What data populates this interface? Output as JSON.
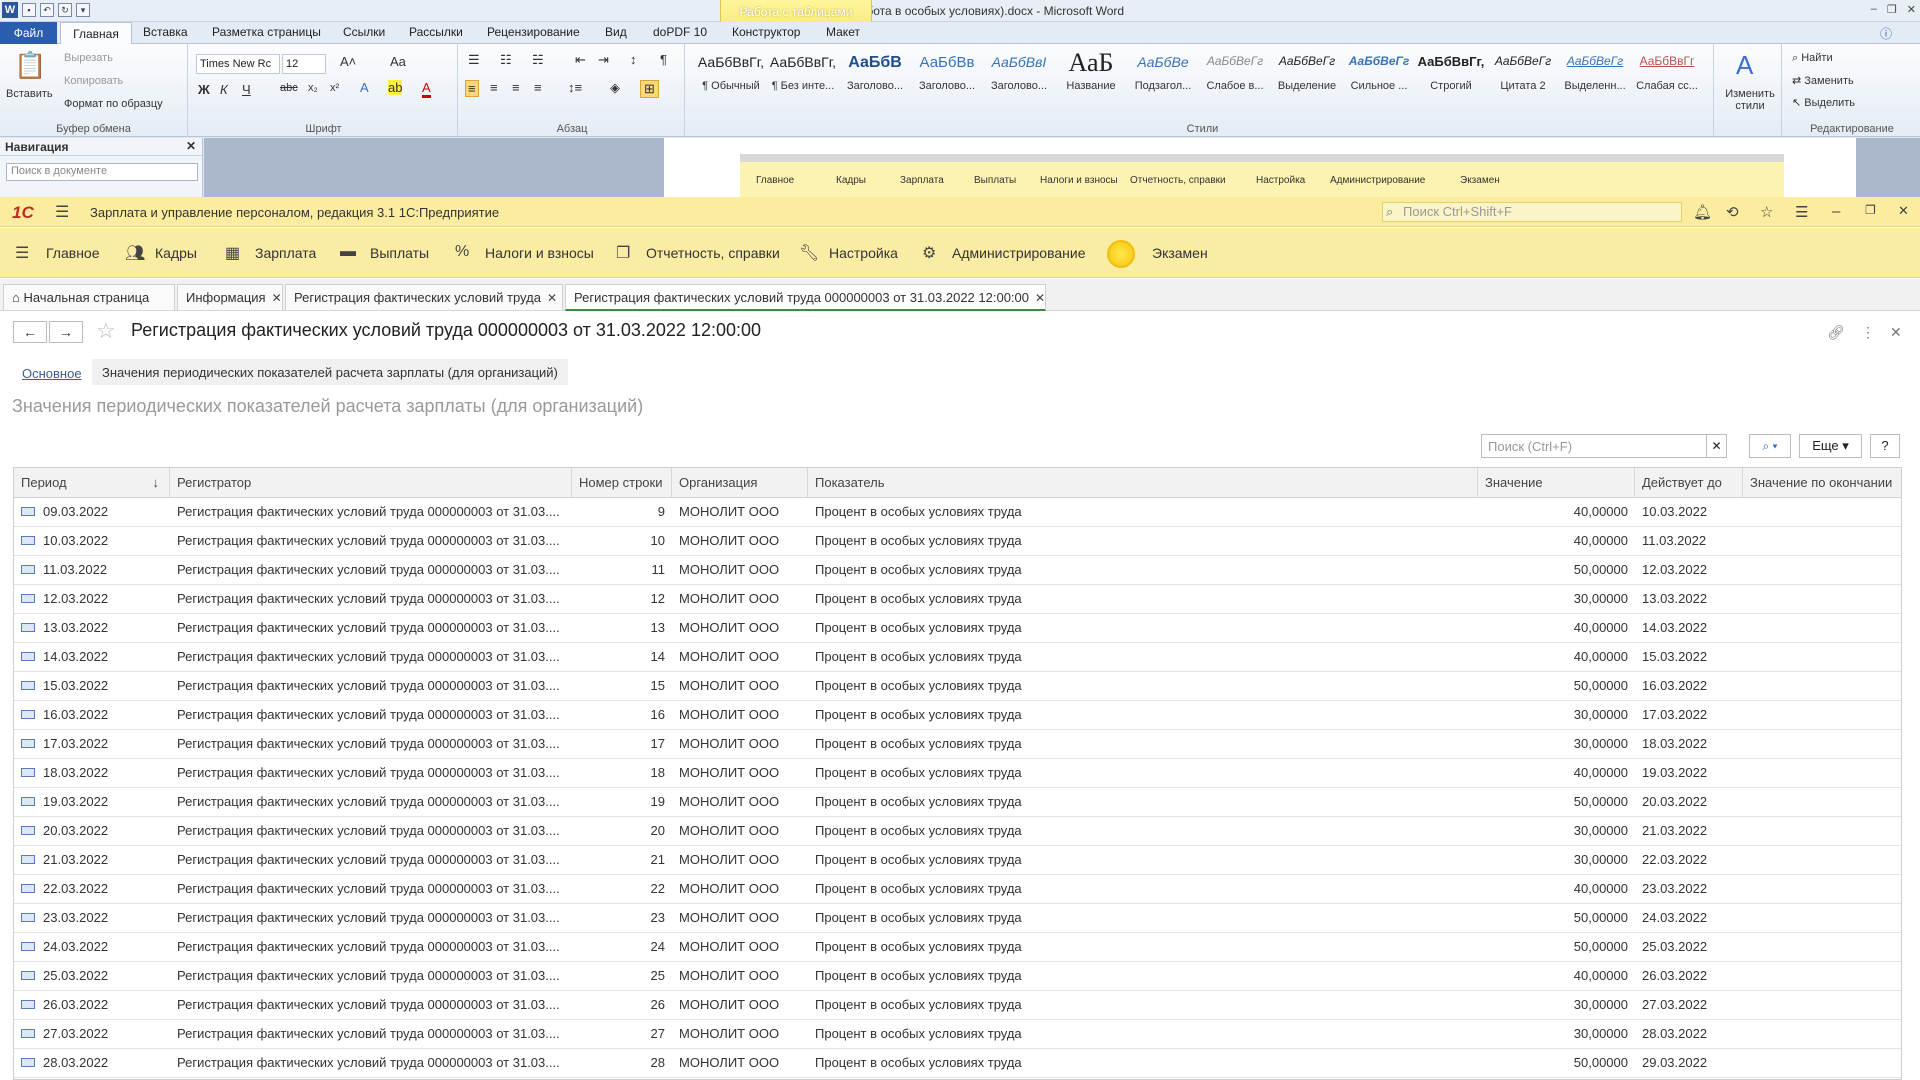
{
  "word": {
    "title": "БИЛЕТ 1 (работа в особых условиях).docx - Microsoft Word",
    "context_tab": "Работа с таблицами",
    "file_tab": "Файл",
    "tabs": [
      "Главная",
      "Вставка",
      "Разметка страницы",
      "Ссылки",
      "Рассылки",
      "Рецензирование",
      "Вид",
      "doPDF 10",
      "Конструктор",
      "Макет"
    ],
    "clipboard": {
      "paste": "Вставить",
      "cut": "Вырезать",
      "copy": "Копировать",
      "format": "Формат по образцу",
      "label": "Буфер обмена"
    },
    "font": {
      "name": "Times New Rc",
      "size": "12",
      "label": "Шрифт"
    },
    "paragraph_label": "Абзац",
    "styles": [
      {
        "sample": "АаБбВвГг,",
        "name": "¶ Обычный"
      },
      {
        "sample": "АаБбВвГг,",
        "name": "¶ Без инте..."
      },
      {
        "sample": "АаБбВ",
        "name": "Заголово..."
      },
      {
        "sample": "АаБбВв",
        "name": "Заголово..."
      },
      {
        "sample": "АаБбВвI",
        "name": "Заголово..."
      },
      {
        "sample": "АаБ",
        "name": "Название"
      },
      {
        "sample": "АаБбВе",
        "name": "Подзагол..."
      },
      {
        "sample": "АаБбВеГг",
        "name": "Слабое в..."
      },
      {
        "sample": "АаБбВеГг",
        "name": "Выделение"
      },
      {
        "sample": "АаБбВеГг",
        "name": "Сильное ..."
      },
      {
        "sample": "АаБбВвГг,",
        "name": "Строгий"
      },
      {
        "sample": "АаБбВеГг",
        "name": "Цитата 2"
      },
      {
        "sample": "АаБбВеГг",
        "name": "Выделенн..."
      },
      {
        "sample": "АаБбВвГг",
        "name": "Слабая сс..."
      }
    ],
    "styles_label": "Стили",
    "change_styles": "Изменить стили",
    "editing": {
      "find": "Найти",
      "replace": "Заменить",
      "select": "Выделить",
      "label": "Редактирование"
    },
    "nav": {
      "title": "Навигация",
      "search_placeholder": "Поиск в документе"
    },
    "mini_menu": [
      "Главное",
      "Кадры",
      "Зарплата",
      "Выплаты",
      "Налоги и взносы",
      "Отчетность, справки",
      "Настройка",
      "Администрирование",
      "Экзамен"
    ]
  },
  "onec": {
    "logo": "1С",
    "app_title": "Зарплата и управление персоналом, редакция 3.1 1С:Предприятие",
    "search_placeholder": "Поиск Ctrl+Shift+F",
    "menu": [
      "Главное",
      "Кадры",
      "Зарплата",
      "Выплаты",
      "Налоги и взносы",
      "Отчетность, справки",
      "Настройка",
      "Администрирование",
      "Экзамен"
    ],
    "tabs": [
      "Начальная страница",
      "Информация",
      "Регистрация фактических условий труда",
      "Регистрация фактических условий труда 000000003 от 31.03.2022 12:00:00"
    ],
    "doc_title": "Регистрация фактических условий труда 000000003 от 31.03.2022 12:00:00",
    "subtabs": {
      "main": "Основное",
      "current": "Значения периодических показателей расчета зарплаты (для организаций)"
    },
    "section_title": "Значения периодических показателей расчета зарплаты (для организаций)",
    "table_search_placeholder": "Поиск (Ctrl+F)",
    "more_label": "Еще",
    "help_label": "?",
    "columns": [
      "Период",
      "Регистратор",
      "Номер строки",
      "Организация",
      "Показатель",
      "Значение",
      "Действует до",
      "Значение по окончании"
    ],
    "rows": [
      [
        "09.03.2022",
        "Регистрация фактических условий труда 000000003 от 31.03....",
        "9",
        "МОНОЛИТ ООО",
        "Процент в особых условиях труда",
        "40,00000",
        "10.03.2022",
        ""
      ],
      [
        "10.03.2022",
        "Регистрация фактических условий труда 000000003 от 31.03....",
        "10",
        "МОНОЛИТ ООО",
        "Процент в особых условиях труда",
        "40,00000",
        "11.03.2022",
        ""
      ],
      [
        "11.03.2022",
        "Регистрация фактических условий труда 000000003 от 31.03....",
        "11",
        "МОНОЛИТ ООО",
        "Процент в особых условиях труда",
        "50,00000",
        "12.03.2022",
        ""
      ],
      [
        "12.03.2022",
        "Регистрация фактических условий труда 000000003 от 31.03....",
        "12",
        "МОНОЛИТ ООО",
        "Процент в особых условиях труда",
        "30,00000",
        "13.03.2022",
        ""
      ],
      [
        "13.03.2022",
        "Регистрация фактических условий труда 000000003 от 31.03....",
        "13",
        "МОНОЛИТ ООО",
        "Процент в особых условиях труда",
        "40,00000",
        "14.03.2022",
        ""
      ],
      [
        "14.03.2022",
        "Регистрация фактических условий труда 000000003 от 31.03....",
        "14",
        "МОНОЛИТ ООО",
        "Процент в особых условиях труда",
        "40,00000",
        "15.03.2022",
        ""
      ],
      [
        "15.03.2022",
        "Регистрация фактических условий труда 000000003 от 31.03....",
        "15",
        "МОНОЛИТ ООО",
        "Процент в особых условиях труда",
        "50,00000",
        "16.03.2022",
        ""
      ],
      [
        "16.03.2022",
        "Регистрация фактических условий труда 000000003 от 31.03....",
        "16",
        "МОНОЛИТ ООО",
        "Процент в особых условиях труда",
        "30,00000",
        "17.03.2022",
        ""
      ],
      [
        "17.03.2022",
        "Регистрация фактических условий труда 000000003 от 31.03....",
        "17",
        "МОНОЛИТ ООО",
        "Процент в особых условиях труда",
        "30,00000",
        "18.03.2022",
        ""
      ],
      [
        "18.03.2022",
        "Регистрация фактических условий труда 000000003 от 31.03....",
        "18",
        "МОНОЛИТ ООО",
        "Процент в особых условиях труда",
        "40,00000",
        "19.03.2022",
        ""
      ],
      [
        "19.03.2022",
        "Регистрация фактических условий труда 000000003 от 31.03....",
        "19",
        "МОНОЛИТ ООО",
        "Процент в особых условиях труда",
        "50,00000",
        "20.03.2022",
        ""
      ],
      [
        "20.03.2022",
        "Регистрация фактических условий труда 000000003 от 31.03....",
        "20",
        "МОНОЛИТ ООО",
        "Процент в особых условиях труда",
        "30,00000",
        "21.03.2022",
        ""
      ],
      [
        "21.03.2022",
        "Регистрация фактических условий труда 000000003 от 31.03....",
        "21",
        "МОНОЛИТ ООО",
        "Процент в особых условиях труда",
        "30,00000",
        "22.03.2022",
        ""
      ],
      [
        "22.03.2022",
        "Регистрация фактических условий труда 000000003 от 31.03....",
        "22",
        "МОНОЛИТ ООО",
        "Процент в особых условиях труда",
        "40,00000",
        "23.03.2022",
        ""
      ],
      [
        "23.03.2022",
        "Регистрация фактических условий труда 000000003 от 31.03....",
        "23",
        "МОНОЛИТ ООО",
        "Процент в особых условиях труда",
        "50,00000",
        "24.03.2022",
        ""
      ],
      [
        "24.03.2022",
        "Регистрация фактических условий труда 000000003 от 31.03....",
        "24",
        "МОНОЛИТ ООО",
        "Процент в особых условиях труда",
        "50,00000",
        "25.03.2022",
        ""
      ],
      [
        "25.03.2022",
        "Регистрация фактических условий труда 000000003 от 31.03....",
        "25",
        "МОНОЛИТ ООО",
        "Процент в особых условиях труда",
        "40,00000",
        "26.03.2022",
        ""
      ],
      [
        "26.03.2022",
        "Регистрация фактических условий труда 000000003 от 31.03....",
        "26",
        "МОНОЛИТ ООО",
        "Процент в особых условиях труда",
        "30,00000",
        "27.03.2022",
        ""
      ],
      [
        "27.03.2022",
        "Регистрация фактических условий труда 000000003 от 31.03....",
        "27",
        "МОНОЛИТ ООО",
        "Процент в особых условиях труда",
        "30,00000",
        "28.03.2022",
        ""
      ],
      [
        "28.03.2022",
        "Регистрация фактических условий труда 000000003 от 31.03....",
        "28",
        "МОНОЛИТ ООО",
        "Процент в особых условиях труда",
        "50,00000",
        "29.03.2022",
        ""
      ]
    ]
  }
}
